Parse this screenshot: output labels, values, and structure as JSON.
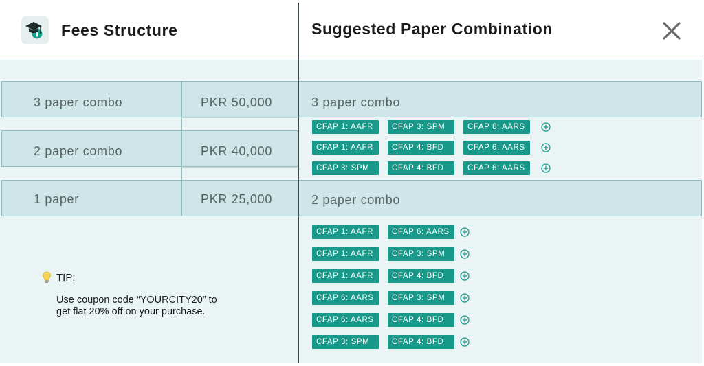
{
  "header": {
    "logo_icon": "graduation-cap-logo",
    "fees_title": "Fees Structure",
    "suggested_title": "Suggested Paper Combination",
    "close_icon": "close-x-icon"
  },
  "fees": {
    "rows": [
      {
        "name": "3 paper combo",
        "price": "PKR 50,000"
      },
      {
        "name": "2 paper combo",
        "price": "PKR 40,000"
      },
      {
        "name": "1 paper",
        "price": "PKR 25,000"
      }
    ]
  },
  "tip": {
    "icon": "lightbulb-icon",
    "label": "TIP:",
    "text": "Use coupon code “YOURCITY20” to get flat 20% off on your purchase."
  },
  "suggestions": {
    "groups": [
      {
        "title": "3 paper combo",
        "combos": [
          [
            "CFAP 1: AAFR",
            "CFAP 3: SPM",
            "CFAP 6: AARS"
          ],
          [
            "CFAP 1: AAFR",
            "CFAP 4: BFD",
            "CFAP 6: AARS"
          ],
          [
            "CFAP 3: SPM",
            "CFAP 4: BFD",
            "CFAP 6: AARS"
          ]
        ]
      },
      {
        "title": "2 paper combo",
        "combos": [
          [
            "CFAP 1: AAFR",
            "CFAP 6: AARS"
          ],
          [
            "CFAP 1: AAFR",
            "CFAP 3: SPM"
          ],
          [
            "CFAP 1: AAFR",
            "CFAP 4: BFD"
          ],
          [
            "CFAP 6: AARS",
            "CFAP 3: SPM"
          ],
          [
            "CFAP 6: AARS",
            "CFAP 4: BFD"
          ],
          [
            "CFAP 3: SPM",
            "CFAP 4: BFD"
          ]
        ]
      }
    ],
    "add_icon": "plus-circle-icon"
  },
  "colors": {
    "chip_bg": "#19998a",
    "row_bg": "#cfe6e9",
    "panel_bg": "#eaf4f5",
    "border": "#93bcc2"
  }
}
